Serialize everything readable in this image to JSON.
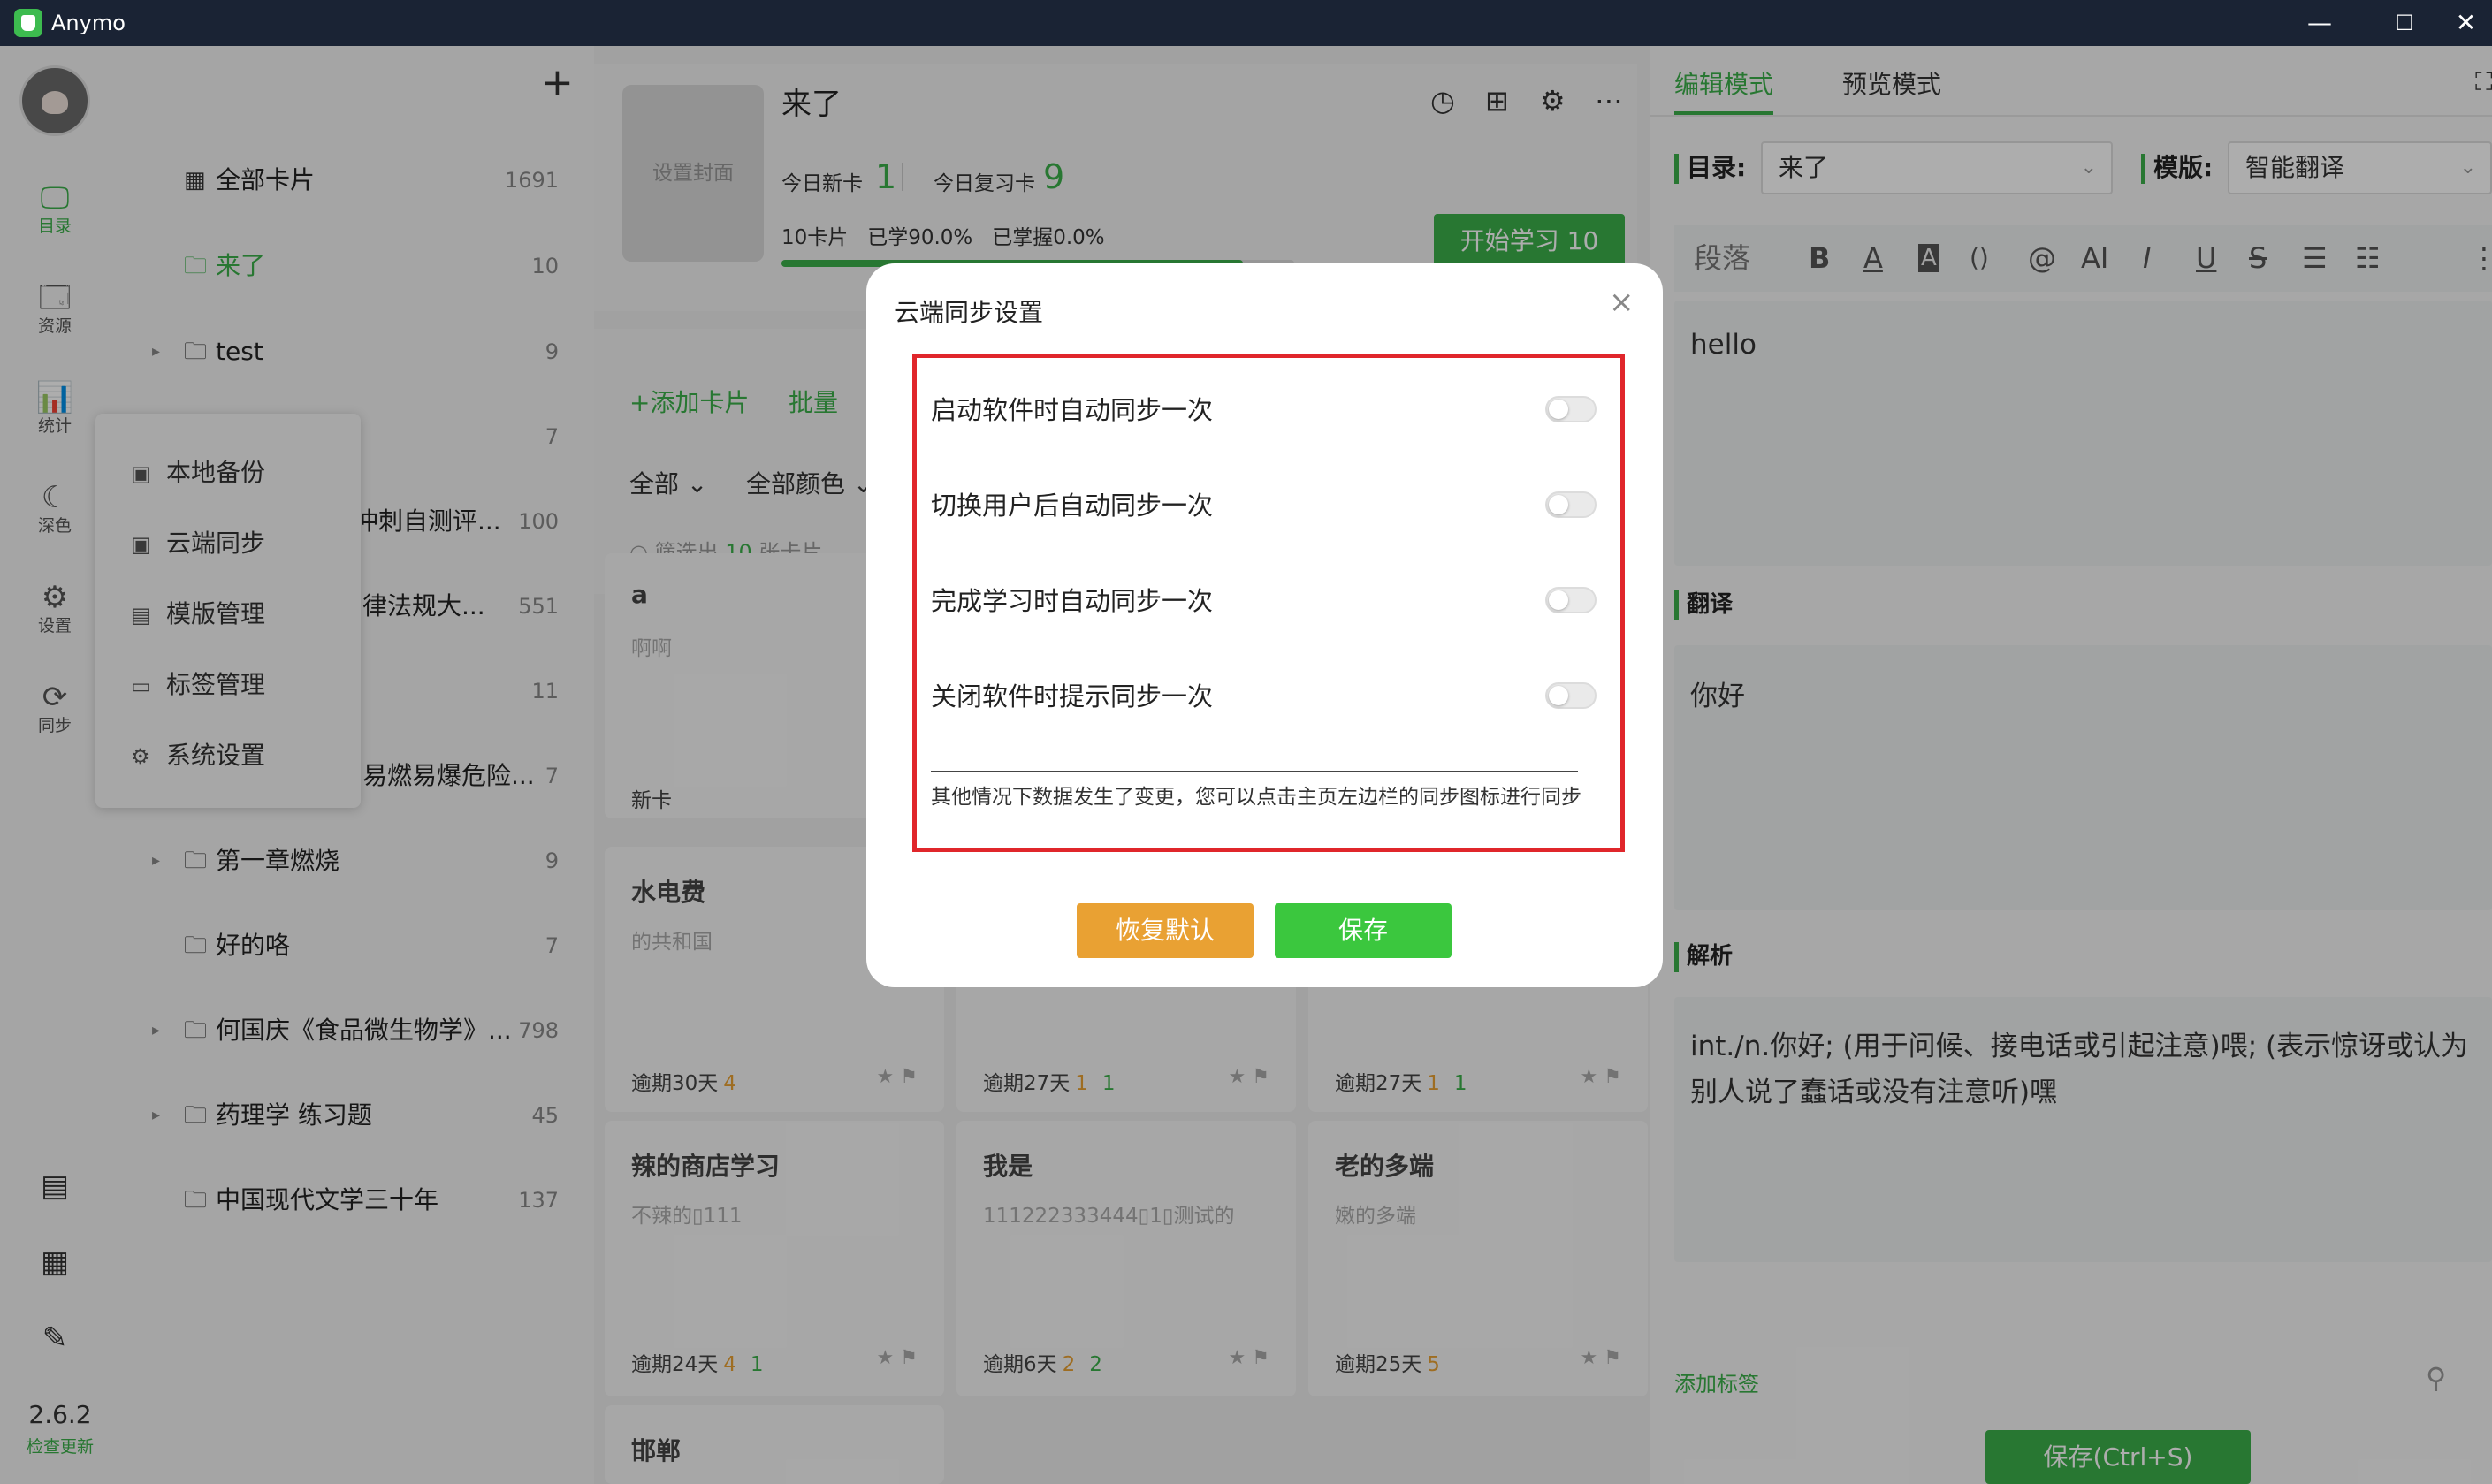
{
  "window": {
    "title": "Anymo",
    "minimize": "—",
    "maximize": "☐",
    "close": "✕"
  },
  "rail": {
    "items": [
      {
        "label": "目录",
        "icon": "monitor-icon",
        "glyph": "🖵"
      },
      {
        "label": "资源",
        "icon": "resource-card-icon",
        "glyph": "🗔"
      },
      {
        "label": "统计",
        "icon": "stats-board-icon",
        "glyph": "📊"
      },
      {
        "label": "深色",
        "icon": "moon-icon",
        "glyph": "☾"
      },
      {
        "label": "设置",
        "icon": "gear-icon",
        "glyph": "⚙"
      },
      {
        "label": "同步",
        "icon": "sync-icon",
        "glyph": "⟳"
      }
    ],
    "bottom_icons": [
      {
        "icon": "notebook-icon",
        "glyph": "▤"
      },
      {
        "icon": "grid-icon",
        "glyph": "▦"
      },
      {
        "icon": "pen-icon",
        "glyph": "✎"
      }
    ],
    "version": "2.6.2",
    "check_update": "检查更新"
  },
  "tree": {
    "add_glyph": "+",
    "rows": [
      {
        "name": "全部卡片",
        "count": "1691"
      },
      {
        "name": "来了",
        "count": "10"
      },
      {
        "name": "test",
        "count": "9"
      },
      {
        "name": "",
        "count": "7"
      },
      {
        "name": "冲刺自测评...",
        "count": "100"
      },
      {
        "name": "律法规大...",
        "count": "551"
      },
      {
        "name": "",
        "count": "11"
      },
      {
        "name": "易燃易爆危险...",
        "count": "7"
      },
      {
        "name": "第一章燃烧",
        "count": "9"
      },
      {
        "name": "好的咯",
        "count": "7"
      },
      {
        "name": "何国庆《食品微生物学》...",
        "count": "798"
      },
      {
        "name": "药理学 练习题",
        "count": "45"
      },
      {
        "name": "中国现代文学三十年",
        "count": "137"
      }
    ]
  },
  "settings_menu": {
    "items": [
      {
        "label": "本地备份",
        "icon": "backup-icon"
      },
      {
        "label": "云端同步",
        "icon": "cloud-sync-icon"
      },
      {
        "label": "模版管理",
        "icon": "template-icon"
      },
      {
        "label": "标签管理",
        "icon": "tag-icon"
      },
      {
        "label": "系统设置",
        "icon": "gear-icon"
      }
    ]
  },
  "deck": {
    "cover_placeholder": "设置封面",
    "name": "来了",
    "new_label": "今日新卡",
    "new_count": "1",
    "review_label": "今日复习卡",
    "review_count": "9",
    "progress_text": "10卡片   已学90.0%   已掌握0.0%",
    "progress_fraction": 0.9,
    "start_label": "开始学习 10",
    "header_icons": [
      "clock-icon",
      "presentation-icon",
      "gear-icon",
      "more-icon"
    ]
  },
  "toolbar": {
    "add_card": "+添加卡片",
    "batch": "批量",
    "filter_all": "全部 ⌄",
    "filter_color": "全部颜色 ⌄",
    "filter_prefix": "筛选出",
    "filter_count": "10",
    "filter_suffix": "张卡片"
  },
  "cards": [
    {
      "title": "a",
      "body": "啊啊",
      "due": "新卡",
      "y": "",
      "g": ""
    },
    {
      "title": "水电费",
      "body": "的共和国",
      "due": "逾期30天",
      "y": "4",
      "g": ""
    },
    {
      "title": "",
      "body": "",
      "due": "逾期27天",
      "y": "1",
      "g": "1"
    },
    {
      "title": "",
      "body": "",
      "due": "逾期27天",
      "y": "1",
      "g": "1"
    },
    {
      "title": "辣的商店学习",
      "body": "不辣的▯111",
      "due": "逾期24天",
      "y": "4",
      "g": "1"
    },
    {
      "title": "我是",
      "body": "111222333444▯1▯测试的",
      "due": "逾期6天",
      "y": "2",
      "g": "2"
    },
    {
      "title": "老的多端",
      "body": "嫩的多端",
      "due": "逾期25天",
      "y": "5",
      "g": ""
    },
    {
      "title": "邯郸",
      "body": "",
      "due": "",
      "y": "",
      "g": ""
    }
  ],
  "editor": {
    "tab_edit": "编辑模式",
    "tab_preview": "预览模式",
    "dir_label": "目录:",
    "dir_value": "来了",
    "tpl_label": "模版:",
    "tpl_value": "智能翻译",
    "format_paragraph": "段落",
    "format_tools": [
      "B",
      "A",
      "A",
      "()",
      "@",
      "AI",
      "I",
      "U",
      "S",
      "☰",
      "☷",
      "⋮"
    ],
    "front_text": "hello",
    "section_translate": "翻译",
    "translate_text": "你好",
    "section_analysis": "解析",
    "analysis_text": "int./n.你好; (用于问候、接电话或引起注意)喂; (表示惊讶或认为别人说了蠢话或没有注意听)嘿",
    "add_tag": "添加标签",
    "save_label": "保存(Ctrl+S)"
  },
  "dialog": {
    "title": "云端同步设置",
    "close": "×",
    "options": [
      {
        "label": "启动软件时自动同步一次",
        "on": false
      },
      {
        "label": "切换用户后自动同步一次",
        "on": false
      },
      {
        "label": "完成学习时自动同步一次",
        "on": false
      },
      {
        "label": "关闭软件时提示同步一次",
        "on": false
      }
    ],
    "note": "其他情况下数据发生了变更，您可以点击主页左边栏的同步图标进行同步",
    "reset_label": "恢复默认",
    "save_label": "保存",
    "highlight_color": "#e0262b"
  },
  "colors": {
    "accent": "#3bb04a",
    "warning": "#e9a133",
    "titlebar": "#1a2334"
  }
}
